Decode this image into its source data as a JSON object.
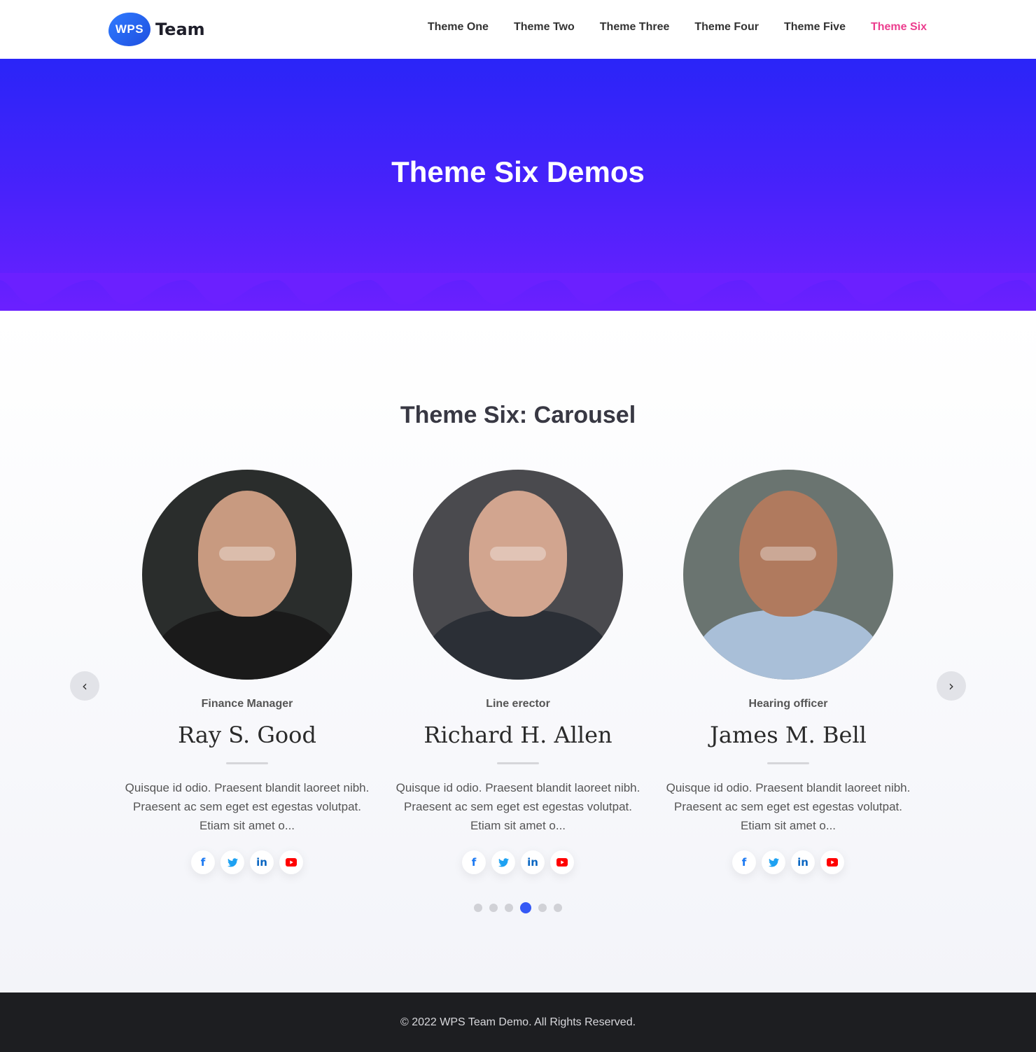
{
  "header": {
    "logo_badge": "WPS",
    "logo_text": "Team",
    "nav": [
      {
        "label": "Theme One"
      },
      {
        "label": "Theme Two"
      },
      {
        "label": "Theme Three"
      },
      {
        "label": "Theme Four"
      },
      {
        "label": "Theme Five"
      },
      {
        "label": "Theme Six"
      }
    ],
    "active_nav_color": "#ec3d8e"
  },
  "hero": {
    "title": "Theme Six Demos",
    "gradient_top": "#2a25f8",
    "gradient_bottom": "#6b20ff"
  },
  "section": {
    "title": "Theme Six: Carousel",
    "members": [
      {
        "role": "Finance Manager",
        "name": "Ray S. Good",
        "description": "Quisque id odio. Praesent blandit laoreet nibh. Praesent ac sem eget est egestas volutpat. Etiam sit amet o...",
        "photo_colors": {
          "bg": "#2a2d2c",
          "skin": "#c89a80",
          "clothes": "#1a1a1a"
        }
      },
      {
        "role": "Line erector",
        "name": "Richard H. Allen",
        "description": "Quisque id odio. Praesent blandit laoreet nibh. Praesent ac sem eget est egestas volutpat. Etiam sit amet o...",
        "photo_colors": {
          "bg": "#4a4a4e",
          "skin": "#d2a58f",
          "clothes": "#2b2f36"
        }
      },
      {
        "role": "Hearing officer",
        "name": "James M. Bell",
        "description": "Quisque id odio. Praesent blandit laoreet nibh. Praesent ac sem eget est egestas volutpat. Etiam sit amet o...",
        "photo_colors": {
          "bg": "#6a7470",
          "skin": "#b07a5e",
          "clothes": "#a9bfd8"
        }
      }
    ],
    "social_icons": [
      "facebook-icon",
      "twitter-icon",
      "linkedin-icon",
      "youtube-icon"
    ],
    "social_colors": {
      "facebook": "#1877f2",
      "twitter": "#1da1f2",
      "linkedin": "#0a66c2",
      "youtube": "#ff0000"
    },
    "prev_arrow": "‹",
    "next_arrow": "›",
    "pagination": {
      "total": 6,
      "active": 4
    },
    "dot_active_color": "#3559f5"
  },
  "footer": {
    "copyright": "© 2022 WPS Team Demo. All Rights Reserved."
  }
}
